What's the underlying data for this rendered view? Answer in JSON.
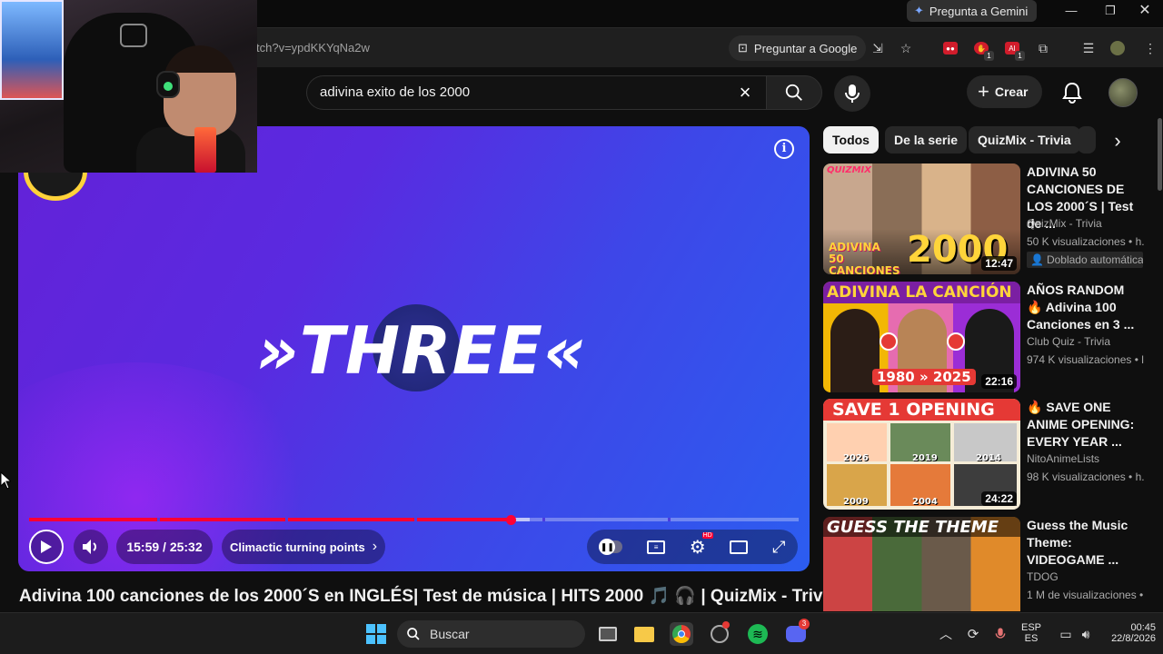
{
  "browser": {
    "gemini_label": "Pregunta a Gemini",
    "url_partial": "tch?v=ypdKKYqNa2w",
    "ask_google_label": "Preguntar a Google"
  },
  "header": {
    "search_value": "adivina exito de los 2000",
    "create_label": "Crear"
  },
  "player": {
    "overlay_word": "»THREE«",
    "current_time": "15:59",
    "duration": "25:32",
    "time_display": "15:59 / 25:32",
    "chapter_label": "Climactic turning points",
    "progress_fraction": 0.626,
    "buffered_fraction": 0.65
  },
  "video_title": "Adivina 100 canciones de los 2000´S en INGLÉS| Test de música | HITS 2000 🎵 🎧  | QuizMix - Trivia",
  "chips": [
    "Todos",
    "De la serie",
    "QuizMix - Trivia"
  ],
  "related": [
    {
      "title": "ADIVINA 50 CANCIONES DE LOS 2000´S | Test de ...",
      "channel": "QuizMix - Trivia",
      "views": "50 K visualizaciones • h.",
      "extra": "Doblado automática",
      "duration": "12:47",
      "thumb_top": "QUIZMIX",
      "thumb_bottom_a": "ADIVINA 50 CANCIONES",
      "thumb_bottom_b": "2000"
    },
    {
      "title": "AÑOS RANDOM 🔥 Adivina 100 Canciones en 3 ...",
      "channel": "Club Quiz - Trivia",
      "views": "974 K visualizaciones • l",
      "duration": "22:16",
      "thumb_top": "ADIVINA LA CANCIÓN",
      "thumb_bottom": "1980 » 2025"
    },
    {
      "title": "🔥 SAVE ONE ANIME OPENING: EVERY YEAR ...",
      "channel": "NitoAnimeLists",
      "views": "98 K visualizaciones • h.",
      "duration": "24:22",
      "thumb_top": "SAVE 1 OPENING",
      "years": [
        "2026",
        "2019",
        "2014",
        "2009",
        "2004"
      ]
    },
    {
      "title": "Guess the Music Theme: VIDEOGAME ...",
      "channel": "TDOG",
      "views": "1 M de visualizaciones •",
      "thumb_top": "GUESS THE THEME"
    }
  ],
  "taskbar": {
    "search_label": "Buscar",
    "lang_top": "ESP",
    "lang_bottom": "ES",
    "time": "00:45",
    "date": "22/8/2026",
    "discord_badge": "3"
  },
  "colors": {
    "youtube_red": "#ff0033",
    "player_purple": "#6322d8",
    "player_blue": "#2c5df0"
  }
}
